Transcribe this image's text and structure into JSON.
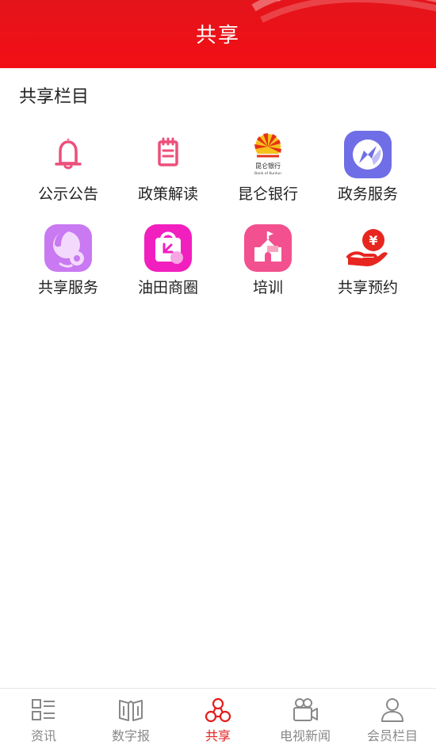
{
  "header": {
    "title": "共享"
  },
  "section": {
    "title": "共享栏目"
  },
  "grid": {
    "items": [
      {
        "label": "公示公告",
        "icon": "bell-icon"
      },
      {
        "label": "政策解读",
        "icon": "clipboard-icon"
      },
      {
        "label": "昆仑银行",
        "icon": "kunlun-bank-logo",
        "logo_text": "昆仑银行",
        "logo_subtext": "Bank of Kunlun"
      },
      {
        "label": "政务服务",
        "icon": "compass-icon"
      },
      {
        "label": "共享服务",
        "icon": "customer-service-icon"
      },
      {
        "label": "油田商圈",
        "icon": "shopping-bag-icon"
      },
      {
        "label": "培训",
        "icon": "school-building-icon"
      },
      {
        "label": "共享预约",
        "icon": "hand-coin-icon",
        "coin_symbol": "¥"
      }
    ]
  },
  "tabbar": {
    "active": "共享",
    "tabs": [
      {
        "label": "资讯",
        "icon": "list-grid-icon"
      },
      {
        "label": "数字报",
        "icon": "newspaper-icon"
      },
      {
        "label": "共享",
        "icon": "share-circles-icon"
      },
      {
        "label": "电视新闻",
        "icon": "video-camera-icon"
      },
      {
        "label": "会员栏目",
        "icon": "user-icon"
      }
    ]
  },
  "colors": {
    "header_red": "#e4141b",
    "active_red": "#e41b1b",
    "inactive_gray": "#888888",
    "bell_pink": "#ec4f7a",
    "compass_purple": "#6f6ee6",
    "service_violet": "#c979f1",
    "bag_magenta": "#f21fbf",
    "school_pink": "#f2508e",
    "hand_red": "#e7261f"
  }
}
